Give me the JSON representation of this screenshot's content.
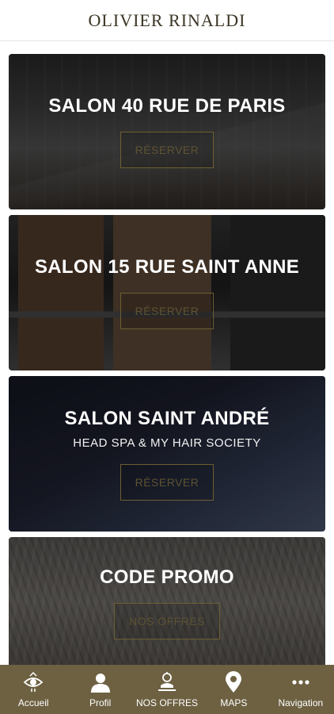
{
  "header": {
    "title": "OLIVIER RINALDI"
  },
  "cards": [
    {
      "title": "SALON 40 RUE DE PARIS",
      "button_label": "RÉSERVER"
    },
    {
      "title": "SALON 15 RUE SAINT ANNE",
      "button_label": "RÉSERVER"
    },
    {
      "title": "SALON SAINT ANDRÉ",
      "subtitle": "HEAD SPA & MY HAIR SOCIETY",
      "button_label": "RÉSERVER"
    },
    {
      "title": "CODE PROMO",
      "button_label": "NOS OFFRES"
    }
  ],
  "tabbar": {
    "items": [
      {
        "label": "Accueil",
        "icon": "eye-icon"
      },
      {
        "label": "Profil",
        "icon": "user-icon"
      },
      {
        "label": "NOS OFFRES",
        "icon": "offers-icon"
      },
      {
        "label": "MAPS",
        "icon": "map-pin-icon"
      },
      {
        "label": "Navigation",
        "icon": "more-dots-icon"
      }
    ]
  },
  "colors": {
    "brand_gold": "#6d6142",
    "button_border": "#6d5f32",
    "header_text": "#3b3524"
  }
}
